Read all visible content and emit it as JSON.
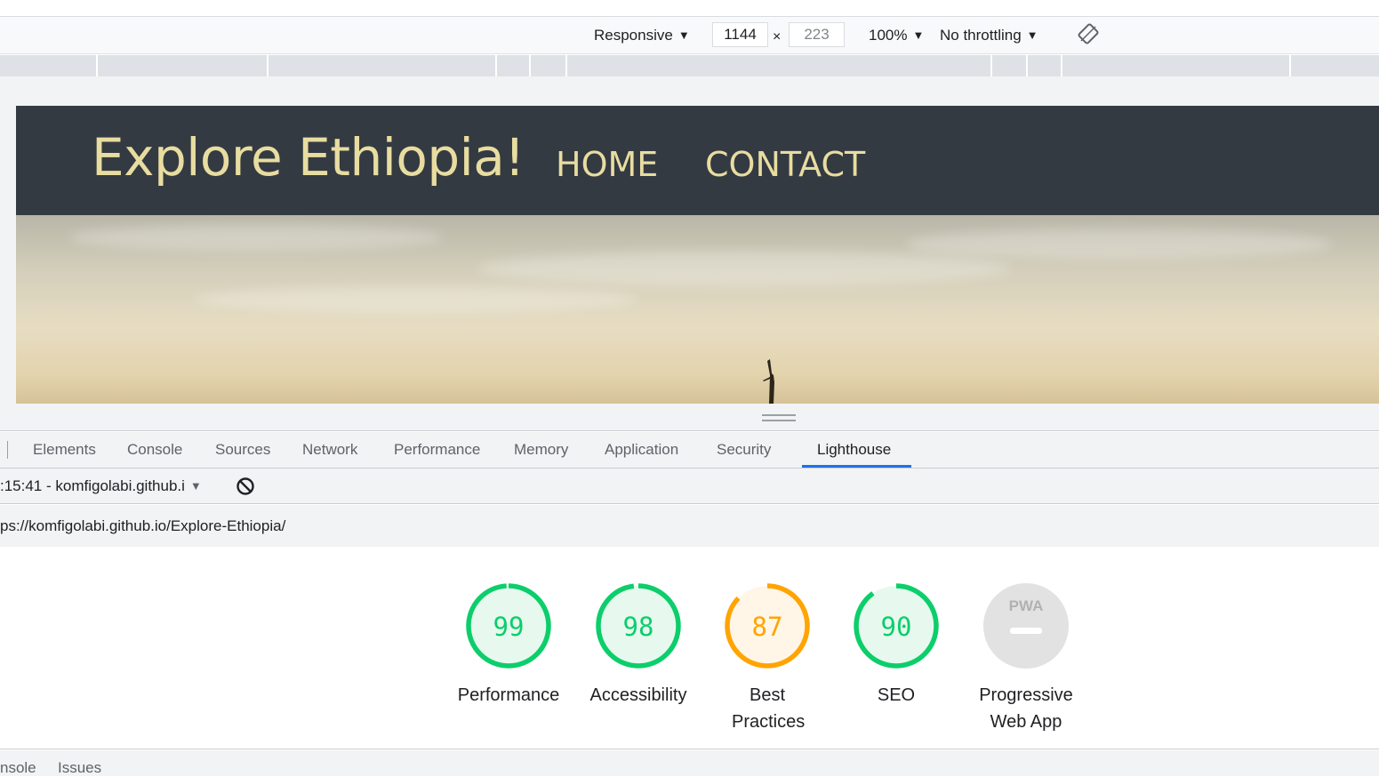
{
  "device_toolbar": {
    "mode": "Responsive",
    "width": "1144",
    "height": "223",
    "zoom": "100%",
    "throttling": "No throttling",
    "rotate_icon": "rotate-icon"
  },
  "site": {
    "brand": "Explore Ethiopia!",
    "nav": [
      "HOME",
      "CONTACT"
    ]
  },
  "devtools": {
    "tabs": [
      "Elements",
      "Console",
      "Sources",
      "Network",
      "Performance",
      "Memory",
      "Application",
      "Security",
      "Lighthouse"
    ],
    "active_tab": "Lighthouse"
  },
  "lighthouse": {
    "report_label": ":15:41 - komfigolabi.github.i",
    "url": "ps://komfigolabi.github.io/Explore-Ethiopia/",
    "scores": [
      {
        "label": "Performance",
        "score": "99",
        "value": 99,
        "status": "pass"
      },
      {
        "label": "Accessibility",
        "score": "98",
        "value": 98,
        "status": "pass"
      },
      {
        "label": "Best Practices",
        "score": "87",
        "value": 87,
        "status": "average"
      },
      {
        "label": "SEO",
        "score": "90",
        "value": 90,
        "status": "pass"
      },
      {
        "label": "Progressive Web App",
        "score": "PWA",
        "value": null,
        "status": "na"
      }
    ],
    "colors": {
      "pass": "#0cce6b",
      "pass_bg": "#e7f9ee",
      "average": "#ffa400",
      "average_bg": "#fff6e8",
      "na": "#e2e2e2"
    }
  },
  "bottom_drawer": {
    "tabs": [
      "nsole",
      "Issues"
    ]
  }
}
